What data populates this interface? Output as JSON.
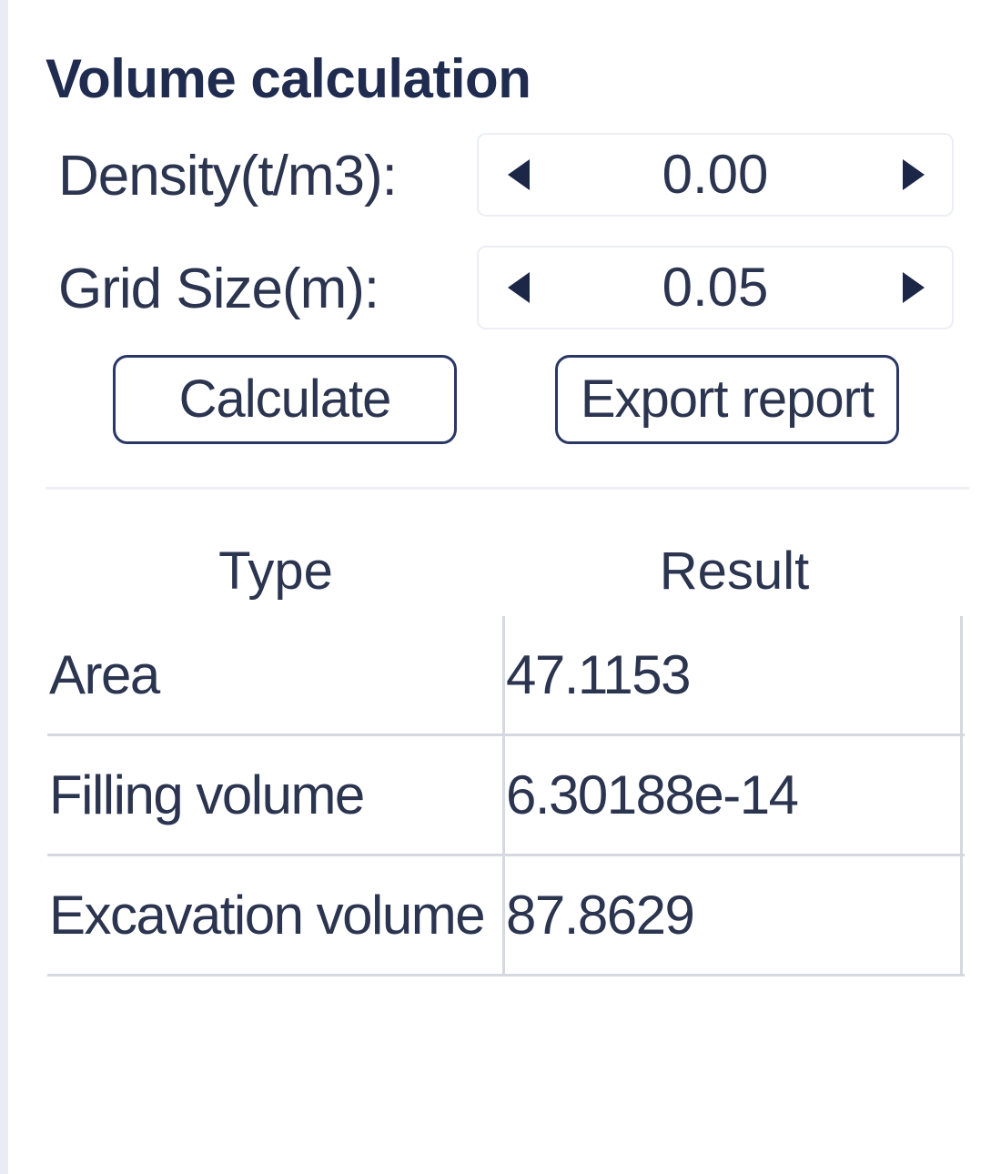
{
  "panel": {
    "title": "Volume calculation"
  },
  "density": {
    "label": "Density(t/m3):",
    "value": "0.00"
  },
  "grid_size": {
    "label": "Grid Size(m):",
    "value": "0.05"
  },
  "buttons": {
    "calculate": "Calculate",
    "export_report": "Export report"
  },
  "results_table": {
    "headers": {
      "type": "Type",
      "result": "Result"
    },
    "rows": [
      {
        "type": "Area",
        "result": "47.1153"
      },
      {
        "type": "Filling volume",
        "result": "6.30188e-14"
      },
      {
        "type": "Excavation volume",
        "result": "87.8629"
      }
    ]
  },
  "icons": {
    "decrement": "triangle-left-icon",
    "increment": "triangle-right-icon"
  },
  "colors": {
    "title_text": "#1f2b4f",
    "text": "#2c3550",
    "button_border": "#2a3764",
    "grid_line": "#d6d8df"
  }
}
